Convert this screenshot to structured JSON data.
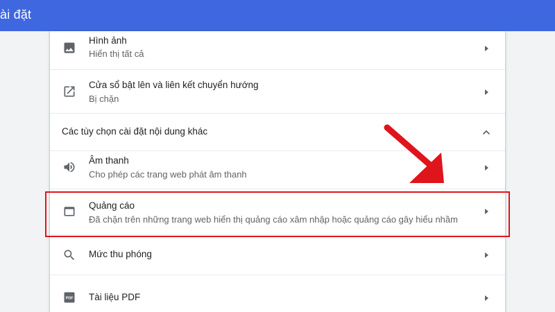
{
  "header": {
    "title": "ài đặt"
  },
  "rows_top": [
    {
      "label": "Hình ảnh",
      "sub": "Hiển thị tất cả",
      "icon": "image-icon"
    },
    {
      "label": "Cửa sổ bật lên và liên kết chuyển hướng",
      "sub": "Bị chặn",
      "icon": "open-in-new-icon"
    }
  ],
  "section": {
    "label": "Các tùy chọn cài đặt nội dung khác",
    "icon": "chevron-up-icon"
  },
  "rows_more": [
    {
      "label": "Âm thanh",
      "sub": "Cho phép các trang web phát âm thanh",
      "icon": "volume-icon"
    },
    {
      "label": "Quảng cáo",
      "sub": "Đã chặn trên những trang web hiển thị quảng cáo xâm nhập hoặc quảng cáo gây hiểu nhầm",
      "icon": "ads-window-icon"
    },
    {
      "label": "Mức thu phóng",
      "icon": "zoom-search-icon"
    },
    {
      "label": "Tài liệu PDF",
      "icon": "pdf-icon"
    }
  ],
  "colors": {
    "topbar": "#3f67e0",
    "highlight": "#e0141c",
    "icon": "#5f6368"
  },
  "annotation": {
    "highlighted_row": "Quảng cáo",
    "arrow_color": "#e0141c"
  }
}
